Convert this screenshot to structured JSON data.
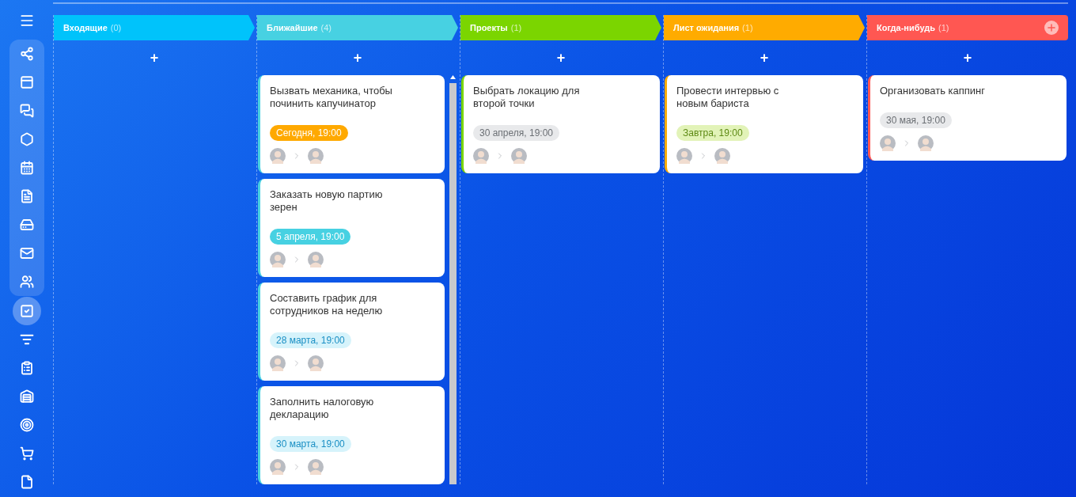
{
  "sidebar": {
    "items": [
      {
        "selected": false
      },
      {
        "selected": false
      },
      {
        "selected": false
      },
      {
        "selected": false
      },
      {
        "selected": false
      },
      {
        "selected": false
      },
      {
        "selected": false
      },
      {
        "selected": false
      },
      {
        "selected": false
      },
      {
        "selected": true
      },
      {
        "selected": false
      },
      {
        "selected": false
      },
      {
        "selected": false
      },
      {
        "selected": false
      },
      {
        "selected": false
      },
      {
        "selected": false
      }
    ]
  },
  "columns": [
    {
      "title": "Входящие",
      "count": "(0)",
      "color": "#00c3fb",
      "add_label": "+",
      "header_add": false
    },
    {
      "title": "Ближайшие",
      "count": "(4)",
      "color": "#47d1e2",
      "add_label": "+",
      "header_add": false,
      "cards": [
        {
          "title": "Вызвать механика, чтобы починить капучинатор",
          "due": {
            "text": "Сегодня, 19:00",
            "kind": "today"
          }
        },
        {
          "title": "Заказать новую партию зерен",
          "due": {
            "text": "5 апреля, 19:00",
            "kind": "soon"
          }
        },
        {
          "title": "Составить график для сотрудников на неделю",
          "due": {
            "text": "28 марта, 19:00",
            "kind": "later"
          }
        },
        {
          "title": "Заполнить налоговую декларацию",
          "due": {
            "text": "30 марта, 19:00",
            "kind": "later"
          }
        }
      ]
    },
    {
      "title": "Проекты",
      "count": "(1)",
      "color": "#7bd500",
      "add_label": "+",
      "header_add": false,
      "cards": [
        {
          "title": "Выбрать локацию для второй точки",
          "due": {
            "text": "30 апреля, 19:00",
            "kind": "far"
          }
        }
      ]
    },
    {
      "title": "Лист ожидания",
      "count": "(1)",
      "color": "#ffab00",
      "add_label": "+",
      "header_add": false,
      "cards": [
        {
          "title": "Провести интервью с новым бариста",
          "due": {
            "text": "Завтра, 19:00",
            "kind": "tomorrow"
          }
        }
      ]
    },
    {
      "title": "Когда-нибудь",
      "count": "(1)",
      "color": "#ff5752",
      "add_label": "+",
      "header_add": true,
      "cards": [
        {
          "title": "Организовать каппинг",
          "due": {
            "text": "30 мая, 19:00",
            "kind": "far"
          }
        }
      ]
    }
  ]
}
